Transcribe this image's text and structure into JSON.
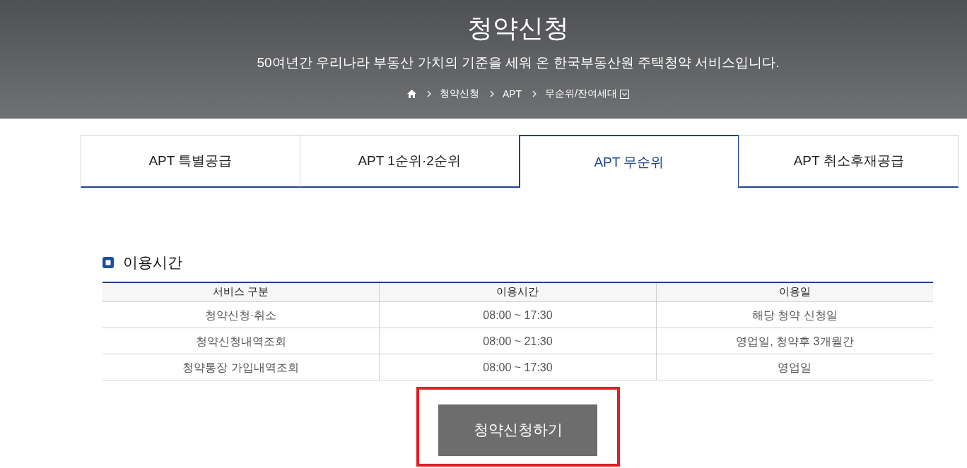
{
  "header": {
    "title": "청약신청",
    "subtitle": "50여년간 우리나라 부동산 가치의 기준을 세워 온 한국부동산원 주택청약 서비스입니다.",
    "breadcrumb": [
      {
        "label": "청약신청",
        "dropdown": false
      },
      {
        "label": "APT",
        "dropdown": false
      },
      {
        "label": "무순위/잔여세대",
        "dropdown": true
      }
    ]
  },
  "tabs": [
    {
      "label": "APT 특별공급",
      "selected": false
    },
    {
      "label": "APT 1순위·2순위",
      "selected": false
    },
    {
      "label": "APT 무순위",
      "selected": true
    },
    {
      "label": "APT 취소후재공급",
      "selected": false
    }
  ],
  "section": {
    "title": "이용시간",
    "table": {
      "columns": [
        "서비스 구분",
        "이용시간",
        "이용일"
      ],
      "rows": [
        [
          "청약신청·취소",
          "08:00 ~ 17:30",
          "해당 청약 신청일"
        ],
        [
          "청약신청내역조회",
          "08:00 ~ 21:30",
          "영업일, 청약후 3개월간"
        ],
        [
          "청약통장 가입내역조회",
          "08:00 ~ 17:30",
          "영업일"
        ]
      ]
    }
  },
  "apply_button": {
    "label": "청약신청하기",
    "highlighted": true
  }
}
